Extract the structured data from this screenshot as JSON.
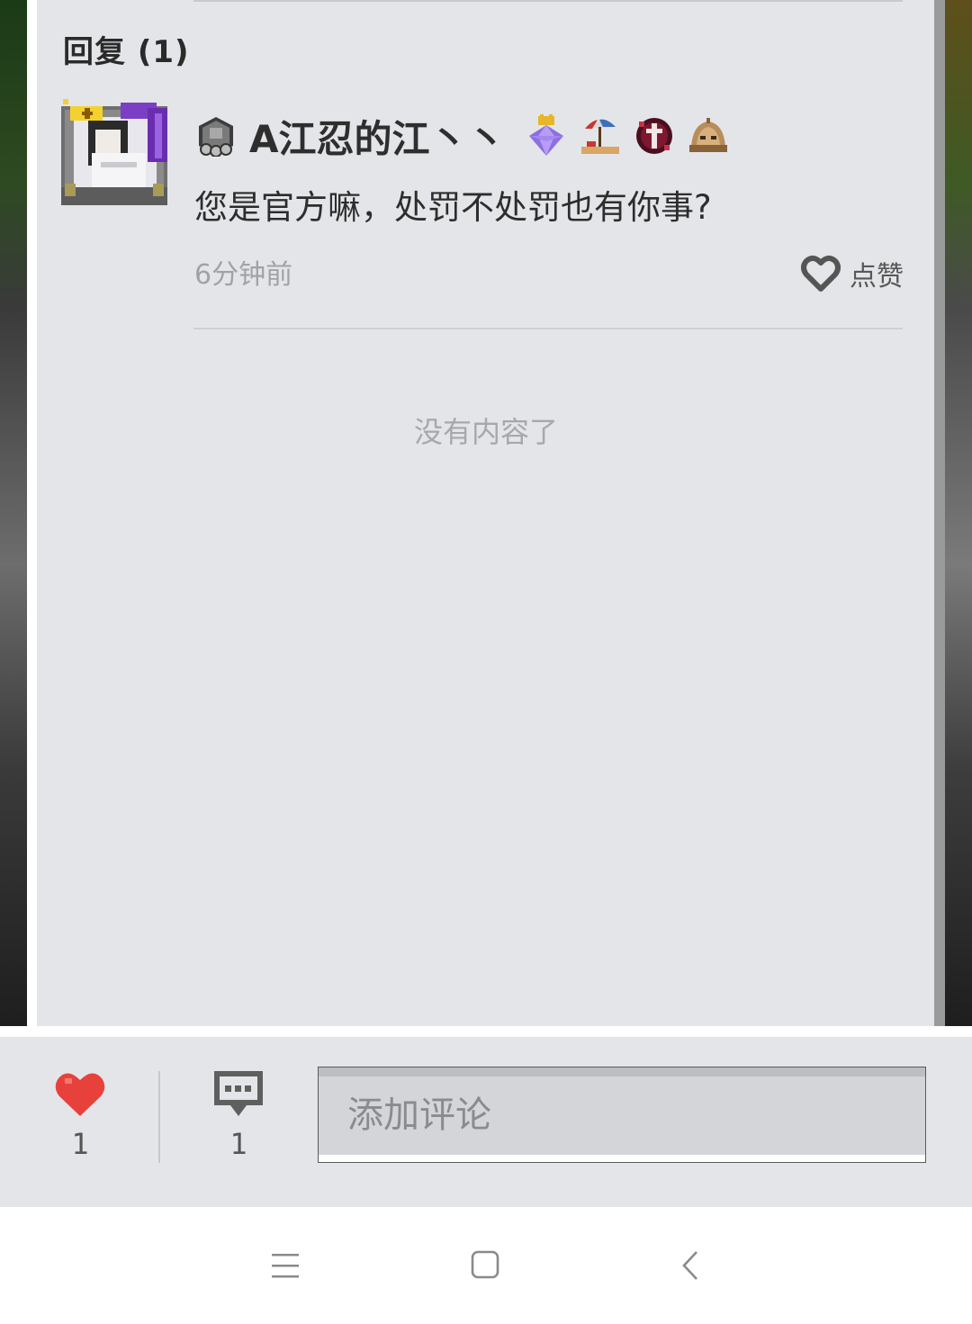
{
  "reply_section": {
    "title": "回复 (1)"
  },
  "comment": {
    "user_name": "A江忍的江丶丶",
    "text": "您是官方嘛，处罚不处罚也有你事?",
    "time": "6分钟前",
    "like_label": "点赞"
  },
  "empty_state": {
    "text": "没有内容了"
  },
  "bottom_bar": {
    "like_count": "1",
    "comment_count": "1",
    "input_placeholder": "添加评论"
  },
  "icons": {
    "user_badge": "stone-block-badge-icon",
    "medals": [
      "purple-gem-crown-icon",
      "beach-umbrella-icon",
      "cross-shield-icon",
      "helmet-icon"
    ],
    "like": "heart-outline-icon",
    "bottom_like": "heart-filled-icon",
    "comment": "speech-bubble-icon",
    "nav": [
      "menu-icon",
      "home-icon",
      "back-icon"
    ]
  },
  "colors": {
    "panel_bg": "#e4e5e9",
    "heart_red": "#e8413c",
    "muted_text": "#a2a2a6"
  }
}
